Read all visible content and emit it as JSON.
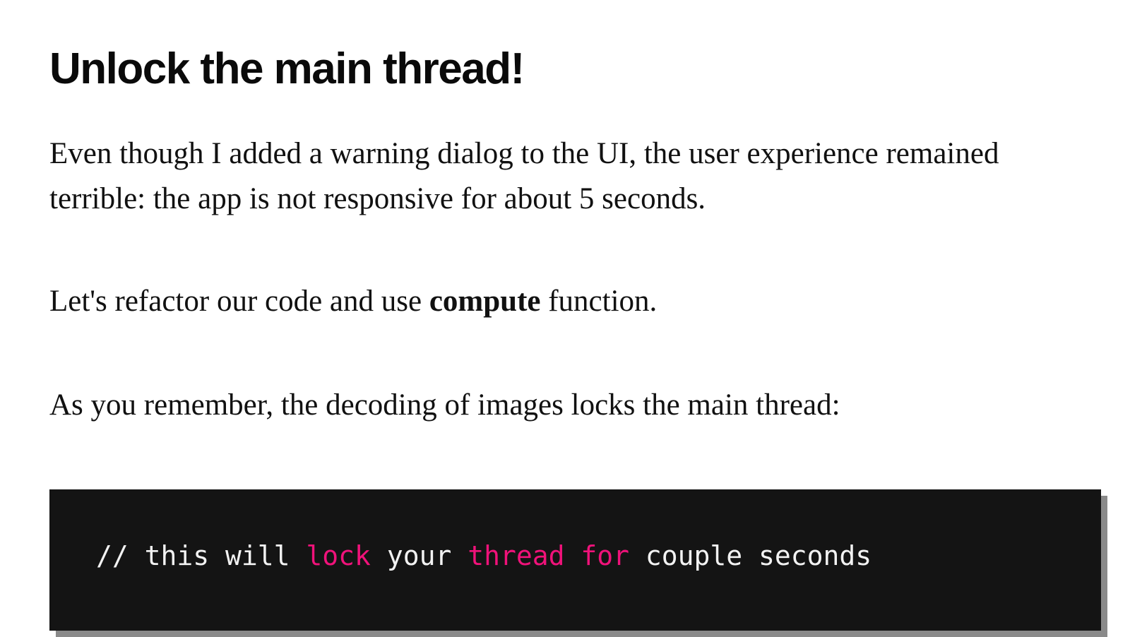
{
  "article": {
    "title": "Unlock the main thread!",
    "p1": "Even though I added a warning dialog to the UI, the user experience remained terrible: the app is not responsive for about 5 seconds.",
    "p2_before": "Let's refactor our code and use ",
    "p2_strong": "compute",
    "p2_after": " function.",
    "p3": "As you remember, the decoding of images locks the main thread:"
  },
  "code": {
    "tokens": {
      "t1": "// this will ",
      "t2": "lock",
      "t3": " your ",
      "t4": "thread for",
      "t5": " couple seconds"
    },
    "colors": {
      "background": "#141414",
      "text": "#f2f2f2",
      "keyword": "#f0127a"
    }
  }
}
